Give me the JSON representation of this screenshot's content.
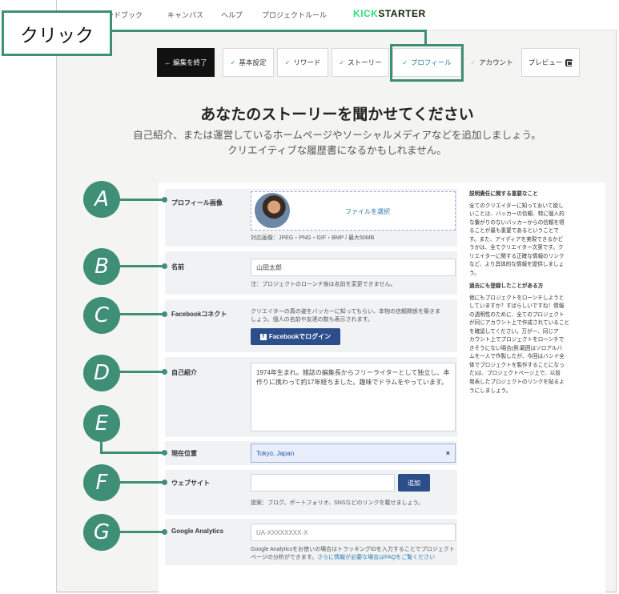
{
  "nav": {
    "links": [
      "ンドブック",
      "キャンパス",
      "ヘルプ",
      "プロジェクトルール"
    ],
    "logo_a": "KICK",
    "logo_b": "STARTER"
  },
  "tabs": {
    "exit": "← 編集を終了",
    "basics": "基本設定",
    "rewards": "リワード",
    "story": "ストーリー",
    "profile": "プロフィール",
    "account": "アカウント",
    "preview": "プレビュー"
  },
  "page": {
    "heading": "あなたのストーリーを聞かせてください",
    "sub1": "自己紹介、または運営しているホームページやソーシャルメディアなどを追加しましょう。",
    "sub2": "クリエイティブな履歴書になるかもしれません。"
  },
  "form": {
    "profile_image": {
      "label": "プロフィール画像",
      "file_select": "ファイルを選択",
      "note": "対応画像：JPEG・PNG・GIF・BMP / 最大50MB"
    },
    "name": {
      "label": "名前",
      "value": "山田太郎",
      "note": "注：プロジェクトのローンチ後は名前を変更できません。"
    },
    "facebook": {
      "label": "Facebookコネクト",
      "desc1": "クリエイターの真の姿をバッカーに知ってもらい、本物の信頼関係を築きま",
      "desc2": "しょう。個人の名前や友達の数も表示されます。",
      "button": "Facebookでログイン",
      "fb_letter": "f"
    },
    "bio": {
      "label": "自己紹介",
      "line1": "1974年生まれ。雑誌の編集長からフリーライターとして独立し、本",
      "line2": "作りに携わって約17年経ちました。趣味でドラムをやっています。"
    },
    "location": {
      "label": "現在位置",
      "value": "Tokyo, Japan",
      "clear": "×"
    },
    "website": {
      "label": "ウェブサイト",
      "value": "",
      "button": "追加",
      "note": "提案：ブログ、ポートフォリオ、SNSなどのリンクを載せましょう。"
    },
    "analytics": {
      "label": "Google Analytics",
      "placeholder": "UA-XXXXXXXX-X",
      "note1": "Google Analyticsをお使いの場合はトラッキングIDを入力することでプロジェクト",
      "note2a": "ページの分析ができます。",
      "note2b": "さらに情報が必要な場合はFAQをご覧ください"
    }
  },
  "sidebar": {
    "title1": "説明責任に関する重要なこと",
    "body1": [
      "全てのクリエイターに知っておいて欲し",
      "いことは、バッカーの信頼、特に個人的",
      "な繋がりのないバッカーからの信頼を得",
      "ることが最も重要であるということで",
      "す。また、アイディアを実現できるかど",
      "うかは、全てクリエイター次第です。ク",
      "リエイターに関する正確な情報のリンク",
      "など、より具体的な情報を提供しましょ",
      "う。"
    ],
    "title2": "過去にも登録したことがある方",
    "body2": [
      "他にもプロジェクトをローンチしようと",
      "していますか？すばらしいですね！情報",
      "の透明性のために、全てのプロジェクト",
      "が同じアカウント上で作成されていること",
      "を確認してください。万が一、同じア",
      "カウント上でプロジェクトをローンチで",
      "きそうにない場合(例:範囲はソロアルバ",
      "ムを一人で作製したが、今回はバンド全",
      "体でプロジェクトを製作することになっ",
      "た)は、プロジェクトページ上で、以前",
      "発表したプロジェクトのリンクを貼るよ",
      "うにしましょう。"
    ]
  },
  "annotations": {
    "click": "クリック",
    "badges": [
      "A",
      "B",
      "C",
      "D",
      "E",
      "F",
      "G"
    ]
  },
  "colors": {
    "annotation_green": "#3f8f76",
    "link_blue": "#2a7ab0",
    "button_navy": "#2c4f8c",
    "kickstarter_green": "#2bde73"
  }
}
